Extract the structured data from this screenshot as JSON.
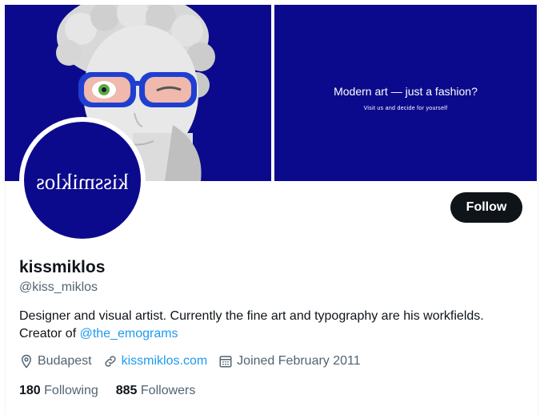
{
  "banner": {
    "headline": "Modern art — just a fashion?",
    "subline": "Visit us and decide for yourself",
    "bg_color": "#0c0a8c"
  },
  "avatar": {
    "text": "kissmiklos",
    "bg_color": "#0c0a8c"
  },
  "actions": {
    "follow_label": "Follow"
  },
  "profile": {
    "name": "kissmiklos",
    "handle": "@kiss_miklos",
    "bio_line1": "Designer and visual artist. Currently the fine art and typography are his workfields.",
    "bio_prefix": "Creator of ",
    "bio_mention": "@the_emograms",
    "location": "Budapest",
    "website": "kissmiklos.com",
    "joined": "Joined February 2011"
  },
  "stats": {
    "following_count": "180",
    "following_label": "Following",
    "followers_count": "885",
    "followers_label": "Followers"
  },
  "colors": {
    "link": "#1d9bf0",
    "secondary_text": "#536471",
    "primary_text": "#0f1419"
  },
  "icons": [
    "location-icon",
    "link-icon",
    "calendar-icon"
  ]
}
